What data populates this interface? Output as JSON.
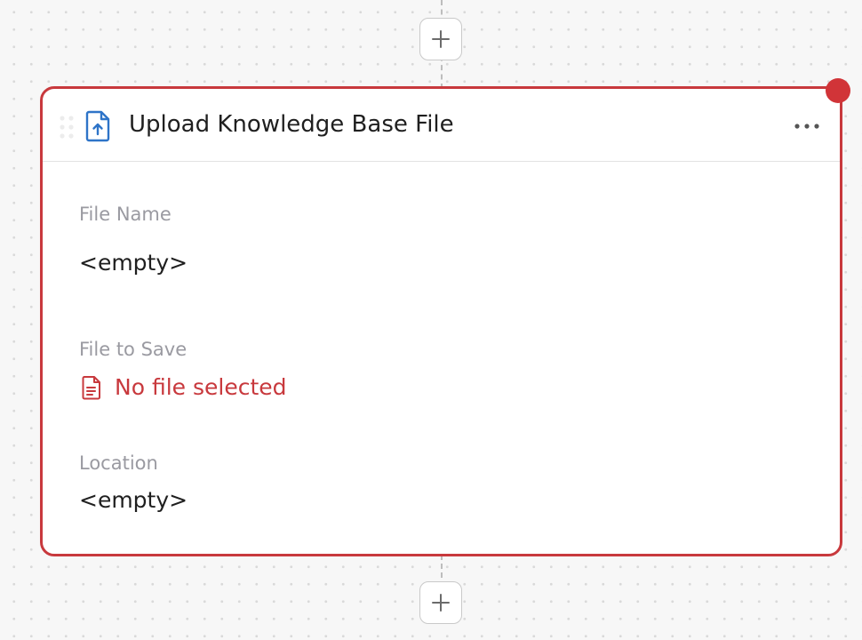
{
  "canvas": {
    "add_step_above": {
      "label": "+",
      "icon": "plus-icon"
    },
    "add_step_below": {
      "label": "+",
      "icon": "plus-icon"
    }
  },
  "step": {
    "title": "Upload Knowledge Base File",
    "icon": "file-upload-icon",
    "menu_icon": "more-horizontal-icon",
    "status": "error",
    "colors": {
      "error": "#c8393d",
      "status_dot": "#d13438",
      "file_icon": "#2e74c8",
      "label": "#9a9aa1",
      "text": "#1f1f1f"
    },
    "fields": {
      "file_name": {
        "label": "File Name",
        "value": "<empty>"
      },
      "file_to_save": {
        "label": "File to Save",
        "value": "No file selected",
        "icon": "file-text-icon"
      },
      "location": {
        "label": "Location",
        "value": "<empty>"
      }
    }
  }
}
